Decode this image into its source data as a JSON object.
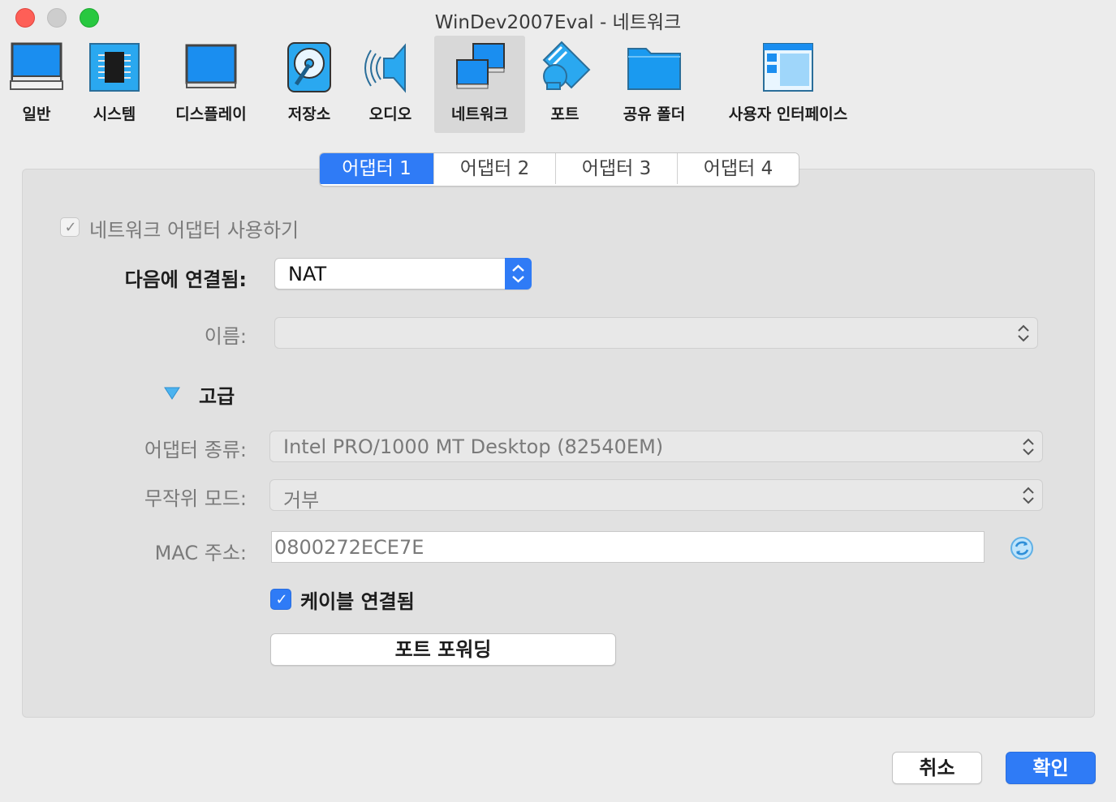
{
  "window": {
    "title": "WinDev2007Eval - 네트워크"
  },
  "toolbar": {
    "items": [
      {
        "label": "일반",
        "icon": "general-monitor-icon"
      },
      {
        "label": "시스템",
        "icon": "system-chip-icon"
      },
      {
        "label": "디스플레이",
        "icon": "display-monitor-icon"
      },
      {
        "label": "저장소",
        "icon": "storage-disk-icon"
      },
      {
        "label": "오디오",
        "icon": "audio-speaker-icon"
      },
      {
        "label": "네트워크",
        "icon": "network-icon",
        "selected": true
      },
      {
        "label": "포트",
        "icon": "port-icon"
      },
      {
        "label": "공유 폴더",
        "icon": "shared-folder-icon"
      },
      {
        "label": "사용자 인터페이스",
        "icon": "user-interface-icon"
      }
    ]
  },
  "tabs": [
    {
      "label": "어댑터 1",
      "active": true
    },
    {
      "label": "어댑터 2"
    },
    {
      "label": "어댑터 3"
    },
    {
      "label": "어댑터 4"
    }
  ],
  "form": {
    "enable_adapter_label": "네트워크 어댑터 사용하기",
    "enable_adapter_checked": true,
    "attached_to_label": "다음에 연결됨:",
    "attached_to_value": "NAT",
    "name_label": "이름:",
    "name_value": "",
    "advanced_label": "고급",
    "adapter_type_label": "어댑터 종류:",
    "adapter_type_value": "Intel PRO/1000 MT Desktop (82540EM)",
    "promiscuous_label": "무작위 모드:",
    "promiscuous_value": "거부",
    "mac_label": "MAC 주소:",
    "mac_value": "0800272ECE7E",
    "cable_label": "케이블 연결됨",
    "cable_checked": true,
    "port_forwarding_label": "포트 포워딩"
  },
  "footer": {
    "cancel_label": "취소",
    "ok_label": "확인"
  },
  "colors": {
    "accent": "#2f7bf6",
    "window_bg": "#ececec",
    "panel_bg": "#e1e1e1"
  }
}
